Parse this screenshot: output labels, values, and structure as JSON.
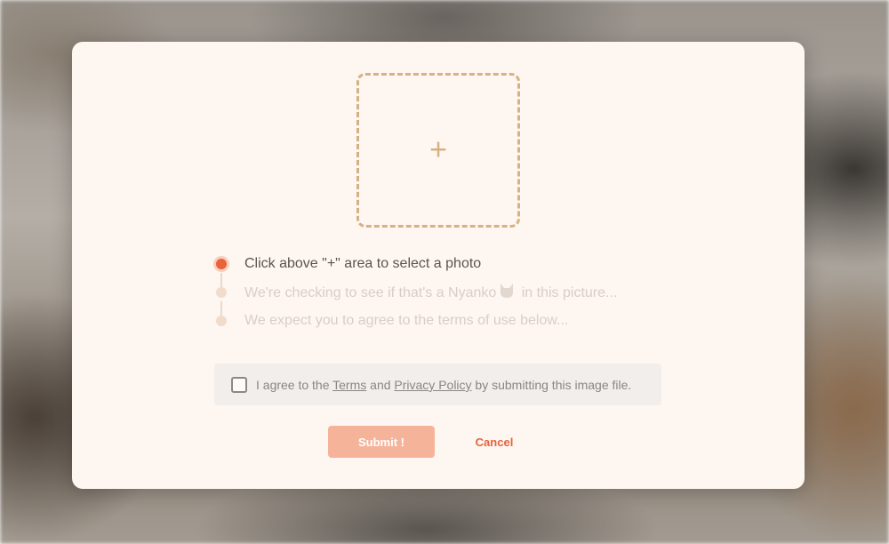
{
  "colors": {
    "accent": "#e8623a",
    "submit_bg": "#f5b49a",
    "dropzone_border": "#d6b184",
    "dialog_bg": "#fdf6f1"
  },
  "dropzone": {
    "icon": "plus-icon",
    "symbol": "+"
  },
  "steps": [
    {
      "text": "Click above \"+\" area to select a photo",
      "status": "active"
    },
    {
      "text_before": "We're checking to see if that's a Nyanko",
      "icon": "cat-icon",
      "text_after": " in this picture...",
      "status": "pending"
    },
    {
      "text": "We expect you to agree to the terms of use below...",
      "status": "pending"
    }
  ],
  "agreement": {
    "prefix": "I agree to the ",
    "terms_link": "Terms",
    "middle": " and ",
    "privacy_link": "Privacy Policy",
    "suffix": " by submitting this image file.",
    "checked": false
  },
  "buttons": {
    "submit_label": "Submit !",
    "cancel_label": "Cancel"
  }
}
